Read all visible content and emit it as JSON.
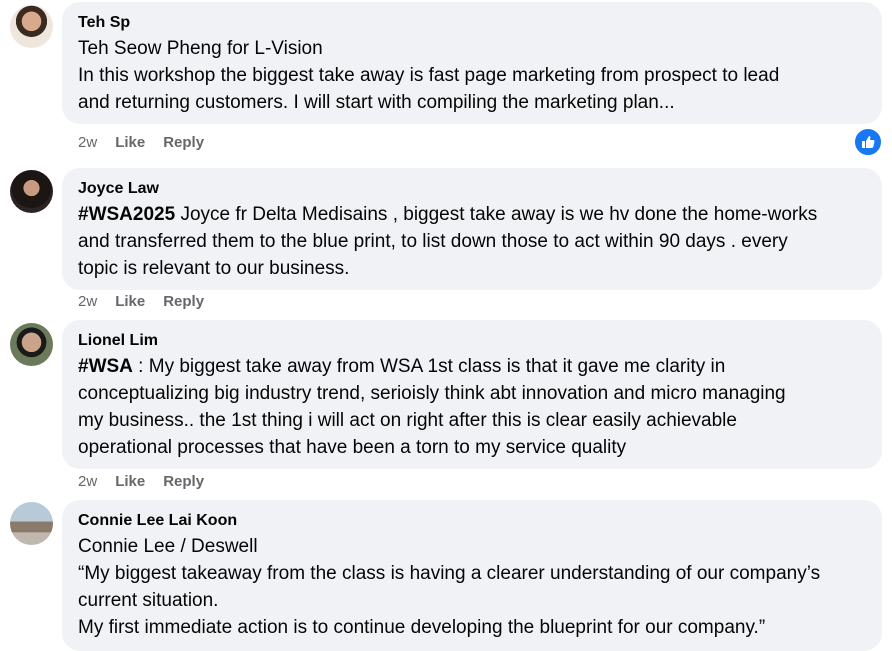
{
  "comments": [
    {
      "author": "Teh Sp",
      "lines": [
        "Teh Seow Pheng for L-Vision",
        "In this workshop the biggest take away is fast page marketing from prospect to lead\nand returning customers. I will start with compiling the marketing plan..."
      ],
      "time": "2w",
      "like": "Like",
      "reply": "Reply"
    },
    {
      "author": "Joyce Law",
      "hashtag": "#WSA2025",
      "body": " Joyce fr Delta Medisains , biggest take away is we hv done the home-works\nand transferred them to the blue print, to list down those to act within 90 days . every\ntopic is relevant to our business.",
      "time": "2w",
      "like": "Like",
      "reply": "Reply"
    },
    {
      "author": "Lionel Lim",
      "hashtag": "#WSA",
      "body": " : My biggest take away from WSA 1st class is that it gave me clarity in\nconceptualizing big industry trend, serioisly think abt innovation and micro managing\nmy business.. the 1st thing i will act on right after this is clear easily achievable\noperational processes that have been a torn to my service quality",
      "time": "2w",
      "like": "Like",
      "reply": "Reply"
    },
    {
      "author": "Connie Lee Lai Koon",
      "body": "Connie Lee / Deswell\n“My biggest takeaway from the class is having a clearer understanding of our company’s\ncurrent situation.\nMy first immediate action is to continue developing the blueprint for our company.”"
    }
  ],
  "reaction": {
    "icon": "thumbs-up-icon",
    "color": "#1877f2"
  }
}
